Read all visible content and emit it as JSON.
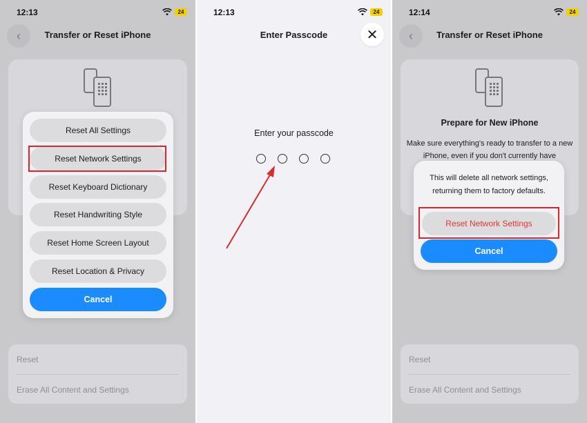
{
  "panel1": {
    "time": "12:13",
    "battery": "24",
    "title": "Transfer or Reset iPhone",
    "sheet_items": [
      "Reset All Settings",
      "Reset Network Settings",
      "Reset Keyboard Dictionary",
      "Reset Handwriting Style",
      "Reset Home Screen Layout",
      "Reset Location & Privacy"
    ],
    "cancel_label": "Cancel",
    "bottom_rows": [
      "Reset",
      "Erase All Content and Settings"
    ]
  },
  "panel2": {
    "time": "12:13",
    "battery": "24",
    "title": "Enter Passcode",
    "prompt": "Enter your passcode",
    "passcode_length": 4
  },
  "panel3": {
    "time": "12:14",
    "battery": "24",
    "title": "Transfer or Reset iPhone",
    "card_title": "Prepare for New iPhone",
    "card_text": "Make sure everything's ready to transfer to a new iPhone, even if you don't currently have",
    "alert_message": "This will delete all network settings, returning them to factory defaults.",
    "alert_action": "Reset Network Settings",
    "cancel_label": "Cancel",
    "bottom_rows": [
      "Reset",
      "Erase All Content and Settings"
    ]
  },
  "colors": {
    "accent": "#1a8cff",
    "highlight": "#d9262c",
    "destructive": "#e0382e",
    "arrow": "#d32f2f"
  }
}
